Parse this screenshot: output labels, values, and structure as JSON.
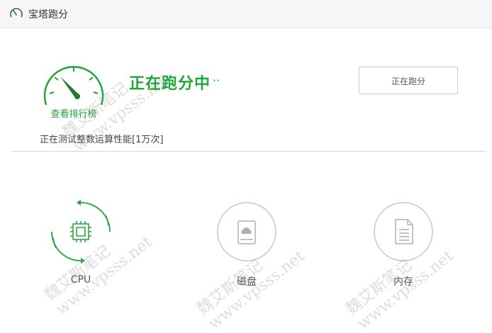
{
  "window": {
    "title": "宝塔跑分"
  },
  "gauge": {
    "label": "查看排行榜"
  },
  "status": {
    "title": "正在跑分中",
    "dots": "··",
    "detail": "正在测试整数运算性能[1万次]"
  },
  "run_button": {
    "label": "正在跑分"
  },
  "tests": [
    {
      "label": "CPU",
      "icon": "cpu-chip-icon",
      "state": "running"
    },
    {
      "label": "磁盘",
      "icon": "disk-icon",
      "state": "pending"
    },
    {
      "label": "内存",
      "icon": "memory-document-icon",
      "state": "pending"
    }
  ],
  "watermark": {
    "line1": "魏艾斯笔记",
    "line2": "www.vpsss.net"
  },
  "colors": {
    "accent": "#20a53a",
    "inactive": "#bbbbbb",
    "divider": "#d8d8d8",
    "titlebar": "#f6f6f6"
  }
}
